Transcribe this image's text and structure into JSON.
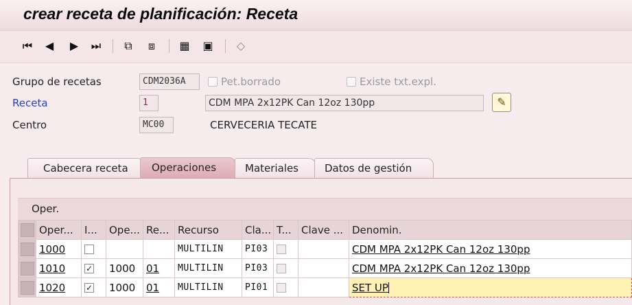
{
  "window": {
    "title": "crear receta de planificación: Receta"
  },
  "toolbar": {
    "buttons": [
      {
        "icon": "first-page-icon",
        "glyph": "⏮"
      },
      {
        "icon": "previous-page-icon",
        "glyph": "◀"
      },
      {
        "icon": "next-page-icon",
        "glyph": "▶"
      },
      {
        "icon": "last-page-icon",
        "glyph": "⏭"
      },
      {
        "icon": "hierarchy-icon",
        "glyph": "⧉"
      },
      {
        "icon": "network-icon",
        "glyph": "⧈"
      },
      {
        "icon": "grid-icon",
        "glyph": "▦"
      },
      {
        "icon": "calendar-icon",
        "glyph": "▣"
      },
      {
        "icon": "cube-icon",
        "glyph": "◇"
      }
    ]
  },
  "header": {
    "group_label": "Grupo de recetas",
    "group_value": "CDM2036A",
    "deleted_label": "Pet.borrado",
    "longtext_label": "Existe txt.expl.",
    "recipe_label": "Receta",
    "recipe_value": "1",
    "recipe_desc": "CDM MPA 2x12PK Can 12oz 130pp",
    "plant_label": "Centro",
    "plant_value": "MC00",
    "plant_name": "CERVECERIA TECATE"
  },
  "tabs": [
    {
      "label": "Cabecera receta",
      "active": false
    },
    {
      "label": "Operaciones",
      "active": true
    },
    {
      "label": "Materiales",
      "active": false
    },
    {
      "label": "Datos de gestión",
      "active": false
    }
  ],
  "table": {
    "title": "Oper.",
    "columns": [
      "Oper...",
      "I...",
      "Ope...",
      "Re...",
      "Recurso",
      "Cla...",
      "T...",
      "Clave ...",
      "Denomin."
    ],
    "rows": [
      {
        "oper": "1000",
        "indicator": false,
        "phase": "",
        "rel": "",
        "resource": "MULTILIN",
        "ctrl": "PI03",
        "text": false,
        "key": "",
        "desc": "CDM MPA 2x12PK Can 12oz 130pp"
      },
      {
        "oper": "1010",
        "indicator": true,
        "phase": "1000",
        "rel": "01",
        "resource": "MULTILIN",
        "ctrl": "PI03",
        "text": false,
        "key": "",
        "desc": "CDM MPA 2x12PK Can 12oz 130pp"
      },
      {
        "oper": "1020",
        "indicator": true,
        "phase": "1000",
        "rel": "01",
        "resource": "MULTILIN",
        "ctrl": "PI01",
        "text": false,
        "key": "",
        "desc": "SET UP"
      }
    ]
  }
}
